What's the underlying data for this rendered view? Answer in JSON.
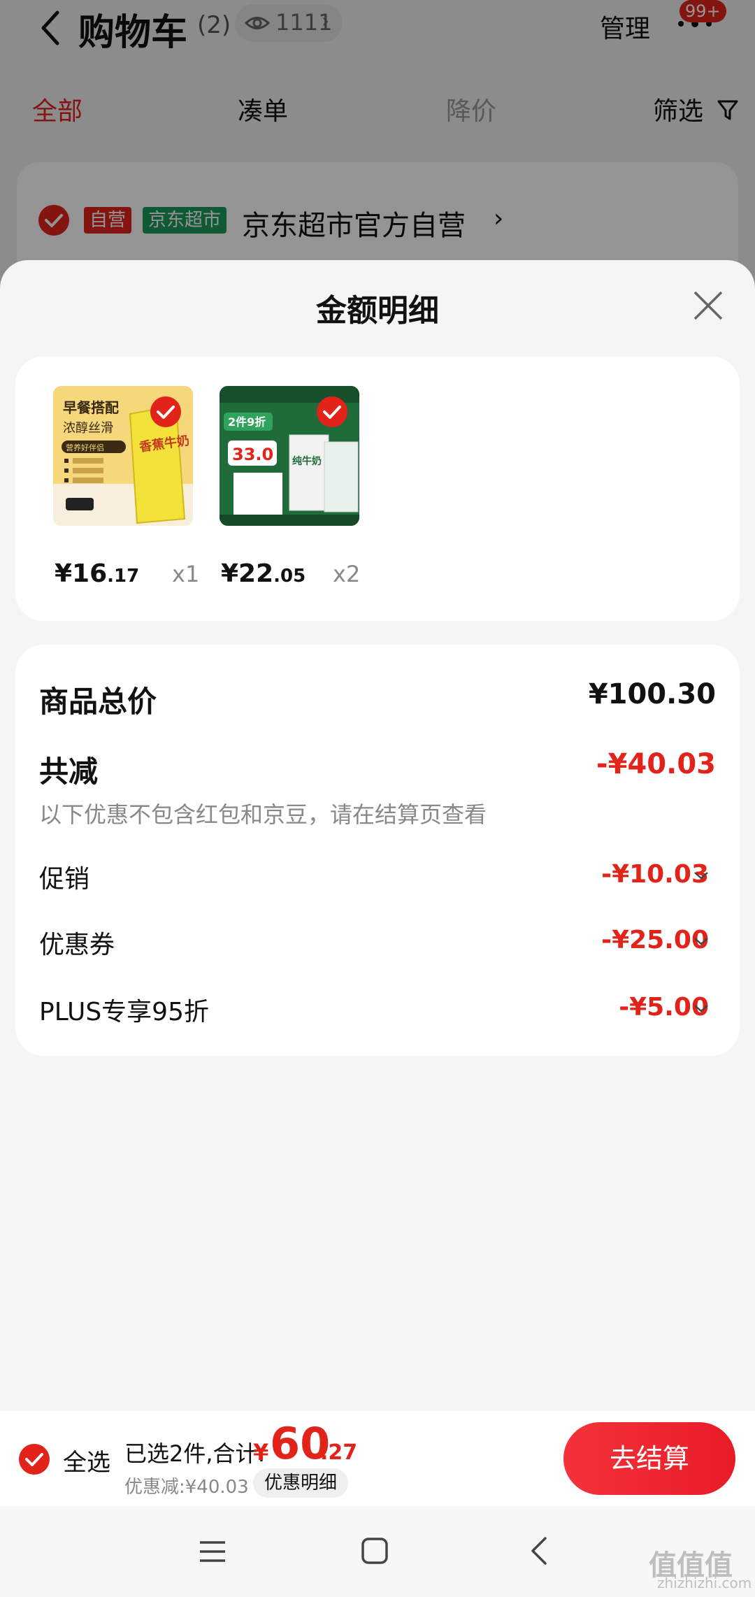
{
  "background": {
    "title": "购物车",
    "count": "(2)",
    "views": "1111",
    "view_chevron": "›",
    "manage": "管理",
    "badge": "99+",
    "tabs": {
      "all": "全部",
      "cou": "凑单",
      "drop": "降价",
      "filter": "筛选"
    },
    "store": {
      "tag_self": "自营",
      "tag_market": "京东超市",
      "name": "京东超市官方自营",
      "chevron": "›"
    }
  },
  "sheet": {
    "title": "金额明细",
    "products": [
      {
        "price_int": "¥16",
        "price_dec": ".17",
        "qty": "x1",
        "image_texts": [
          "早餐搭配",
          "浓醇丝滑",
          "营养好伴侣",
          "香蕉牛奶"
        ]
      },
      {
        "price_int": "¥22",
        "price_dec": ".05",
        "qty": "x2",
        "image_texts": [
          "2件9折",
          "33.0",
          "纯牛奶"
        ]
      }
    ],
    "total_label": "商品总价",
    "total_value": "¥100.30",
    "reduce_label": "共减",
    "reduce_value": "-¥40.03",
    "note": "以下优惠不包含红包和京豆，请在结算页查看",
    "items": [
      {
        "label": "促销",
        "value": "-¥10.03"
      },
      {
        "label": "优惠券",
        "value": "-¥25.00"
      },
      {
        "label": "PLUS专享95折",
        "value": "-¥5.00"
      }
    ]
  },
  "checkout": {
    "select_all": "全选",
    "selected_text": "已选2件,合计:",
    "currency": "¥",
    "total_int": "60",
    "total_dec": ".27",
    "discount_text": "优惠减:¥40.03",
    "detail_button": "优惠明细",
    "pay_button": "去结算"
  },
  "watermark": {
    "main": "值值值",
    "sub": "zhizhizhi.com"
  },
  "colors": {
    "accent": "#e2231a",
    "market_green": "#1a9a5a"
  }
}
